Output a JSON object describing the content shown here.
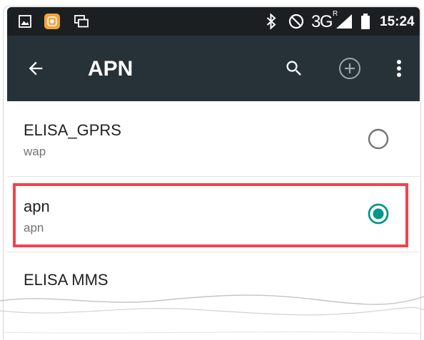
{
  "status_bar": {
    "time": "15:24",
    "network": "3G",
    "roaming": "R",
    "left_icons": [
      "image-icon",
      "mirroring-app-icon",
      "multi-window-icon"
    ],
    "right_icons": [
      "bluetooth-icon",
      "do-not-disturb-icon",
      "signal-icon",
      "battery-icon"
    ]
  },
  "app_bar": {
    "navigation_icon": "arrow-back-icon",
    "title": "APN",
    "action_icons": [
      "search-icon",
      "add-circle-icon",
      "more-vert-icon"
    ]
  },
  "apn_list": {
    "items": [
      {
        "name": "ELISA_GPRS",
        "subtitle": "wap",
        "selected": false
      },
      {
        "name": "apn",
        "subtitle": "apn",
        "selected": true,
        "highlighted": true
      },
      {
        "name": "ELISA MMS"
      }
    ]
  },
  "colors": {
    "status_bar": "#1b1f22",
    "app_bar": "#263238",
    "accent": "#009688",
    "highlight": "#f0444f",
    "radio_unchecked": "#737373",
    "action_muted": "#9aa6ac",
    "app_icon_orange": "#f5a33c"
  }
}
